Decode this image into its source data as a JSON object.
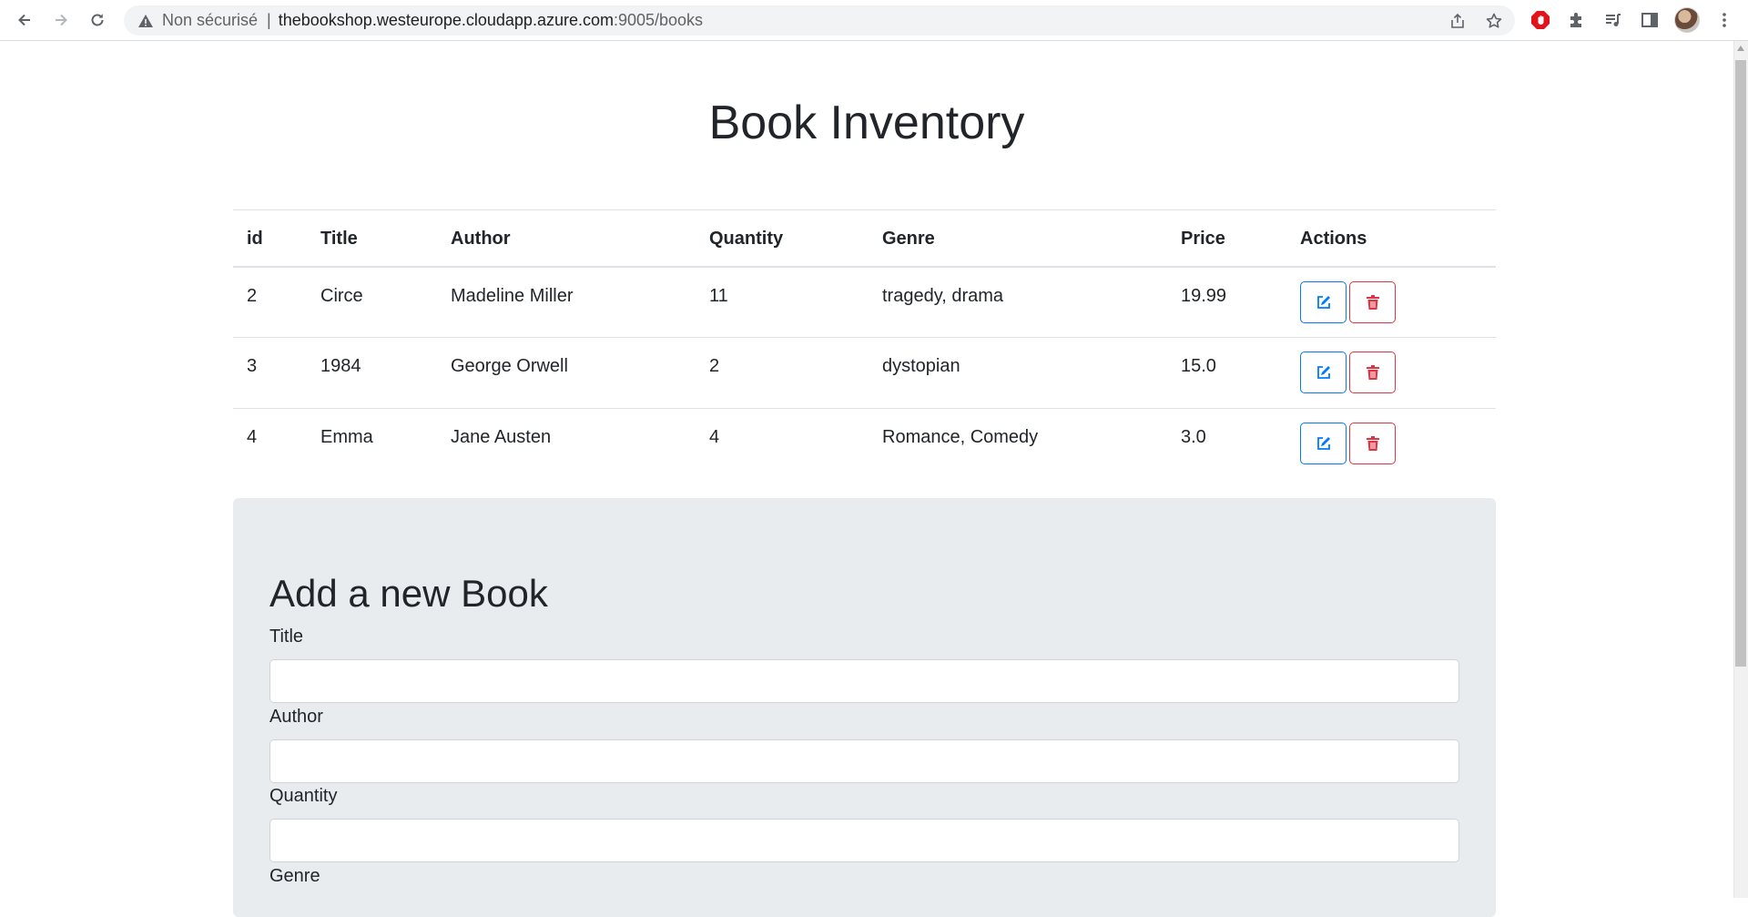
{
  "browser": {
    "security_label": "Non sécurisé",
    "separator": "|",
    "url_host": "thebookshop.westeurope.cloudapp.azure.com",
    "url_path": ":9005/books"
  },
  "page": {
    "title": "Book Inventory"
  },
  "table": {
    "headers": {
      "id": "id",
      "title": "Title",
      "author": "Author",
      "quantity": "Quantity",
      "genre": "Genre",
      "price": "Price",
      "actions": "Actions"
    },
    "rows": [
      {
        "id": "2",
        "title": "Circe",
        "author": "Madeline Miller",
        "quantity": "11",
        "genre": "tragedy, drama",
        "price": "19.99"
      },
      {
        "id": "3",
        "title": "1984",
        "author": "George Orwell",
        "quantity": "2",
        "genre": "dystopian",
        "price": "15.0"
      },
      {
        "id": "4",
        "title": "Emma",
        "author": "Jane Austen",
        "quantity": "4",
        "genre": "Romance, Comedy",
        "price": "3.0"
      }
    ]
  },
  "form": {
    "heading": "Add a new Book",
    "labels": {
      "title": "Title",
      "author": "Author",
      "quantity": "Quantity",
      "genre": "Genre"
    },
    "values": {
      "title": "",
      "author": "",
      "quantity": ""
    }
  },
  "colors": {
    "edit_accent": "#007bff",
    "delete_accent": "#dc3545",
    "form_background": "#e9ecef"
  },
  "icons": {
    "edit": "pencil-square-icon",
    "delete": "trash-icon"
  }
}
